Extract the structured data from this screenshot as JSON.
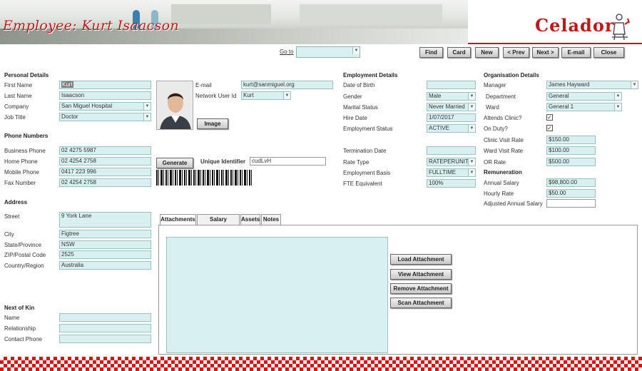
{
  "header": {
    "title": "Employee: Kurt Isaacson",
    "logo": "Celador",
    "logo_icon": "medical-staff-icon"
  },
  "toolbar": {
    "goto_label": "Go to",
    "goto_value": "",
    "buttons": [
      "Find",
      "Card",
      "New",
      "< Prev",
      "Next >",
      "E-mail",
      "Close"
    ]
  },
  "personal": {
    "heading": "Personal Details",
    "first_name_label": "First Name",
    "first_name": "Kurt",
    "last_name_label": "Last Name",
    "last_name": "Isaacson",
    "company_label": "Company",
    "company": "San Miguel Hospital",
    "job_title_label": "Job Title",
    "job_title": "Doctor",
    "email_label": "E-mail",
    "email": "kurt@sanmiguel.org",
    "network_user_label": "Network User Id",
    "network_user": "Kurt",
    "image_button": "Image"
  },
  "phones": {
    "heading": "Phone Numbers",
    "business_label": "Business Phone",
    "business": "02 4275 5987",
    "home_label": "Home Phone",
    "home": "02 4254 2758",
    "mobile_label": "Mobile Phone",
    "mobile": "0417 223 996",
    "fax_label": "Fax Number",
    "fax": "02 4254 2758",
    "generate_button": "Generate",
    "unique_id_label": "Unique Identifier",
    "unique_id": "cudLvH"
  },
  "address": {
    "heading": "Address",
    "street_label": "Street",
    "street": "9 York Lane",
    "city_label": "City",
    "city": "Figtree",
    "state_label": "State/Province",
    "state": "NSW",
    "zip_label": "ZIP/Postal Code",
    "zip": "2525",
    "country_label": "Country/Region",
    "country": "Australia"
  },
  "next_of_kin": {
    "heading": "Next of Kin",
    "name_label": "Name",
    "name": "",
    "relationship_label": "Relationship",
    "relationship": "",
    "contact_label": "Contact Phone",
    "contact": ""
  },
  "employment": {
    "heading": "Employment Details",
    "dob_label": "Date of Birth",
    "dob": "",
    "gender_label": "Gender",
    "gender": "Male",
    "marital_label": "Marital Status",
    "marital": "Never Married",
    "hire_label": "Hire Date",
    "hire": "1/07/2017",
    "status_label": "Employment Status",
    "status": "ACTIVE",
    "termination_label": "Termination Date",
    "termination": "",
    "rate_type_label": "Rate Type",
    "rate_type": "RATEPERUNIT",
    "basis_label": "Employment Basis",
    "basis": "FULLTIME",
    "fte_label": "FTE Equivalent",
    "fte": "100%"
  },
  "organisation": {
    "heading": "Organisation Details",
    "manager_label": "Manager",
    "manager": "James Hayward",
    "department_label": "Department",
    "department": "General",
    "ward_label": "Ward",
    "ward": "General 1",
    "attends_clinic_label": "Attends Clinic?",
    "attends_clinic": "☑",
    "on_duty_label": "On Duty?",
    "on_duty": "☑",
    "clinic_rate_label": "Clinic Visit Rate",
    "clinic_rate": "$150.00",
    "ward_rate_label": "Ward Visit Rate",
    "ward_rate": "$100.00",
    "or_rate_label": "OR Rate",
    "or_rate": "$500.00"
  },
  "remuneration": {
    "heading": "Remuneration",
    "annual_label": "Annual Salary",
    "annual": "$98,800.00",
    "hourly_label": "Hourly Rate",
    "hourly": "$50.00",
    "adjusted_label": "Adjusted Annual Salary",
    "adjusted": ""
  },
  "tabs": [
    "Attachments",
    "Salary Package",
    "Assets",
    "Notes"
  ],
  "attachments": {
    "buttons": [
      "Load Attachment",
      "View Attachment",
      "Remove Attachment",
      "Scan Attachment"
    ]
  },
  "colors": {
    "accent": "#c01818",
    "field_bg": "#d9f0f0"
  }
}
